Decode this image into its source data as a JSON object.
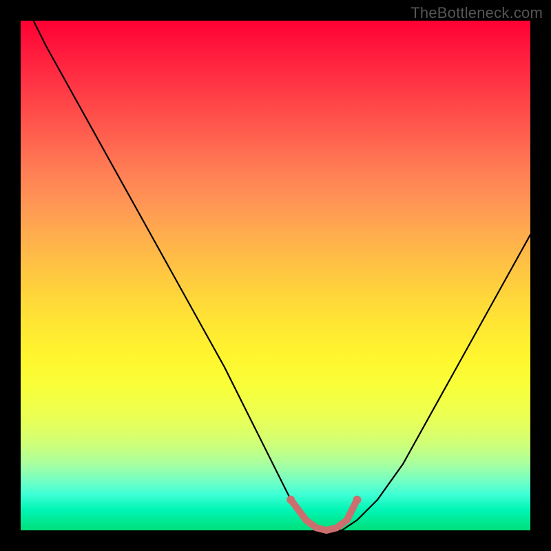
{
  "watermark": "TheBottleneck.com",
  "chart_data": {
    "type": "line",
    "title": "",
    "xlabel": "",
    "ylabel": "",
    "xlim": [
      0,
      1
    ],
    "ylim": [
      0,
      1
    ],
    "series": [
      {
        "name": "curve",
        "x": [
          0.0,
          0.05,
          0.1,
          0.15,
          0.2,
          0.25,
          0.3,
          0.35,
          0.4,
          0.45,
          0.5,
          0.53,
          0.56,
          0.6,
          0.63,
          0.66,
          0.7,
          0.75,
          0.8,
          0.85,
          0.9,
          0.95,
          1.0
        ],
        "y": [
          1.05,
          0.95,
          0.86,
          0.77,
          0.68,
          0.59,
          0.5,
          0.41,
          0.32,
          0.22,
          0.12,
          0.06,
          0.02,
          0.0,
          0.0,
          0.02,
          0.06,
          0.13,
          0.22,
          0.31,
          0.4,
          0.49,
          0.58
        ]
      },
      {
        "name": "flat-highlight",
        "x": [
          0.53,
          0.56,
          0.58,
          0.6,
          0.62,
          0.64,
          0.66
        ],
        "y": [
          0.06,
          0.02,
          0.005,
          0.0,
          0.005,
          0.02,
          0.06
        ]
      }
    ],
    "colors": {
      "curve": "#000000",
      "flat_highlight": "#cc6e6e",
      "gradient_top": "#ff0033",
      "gradient_bottom": "#00df7a"
    }
  }
}
